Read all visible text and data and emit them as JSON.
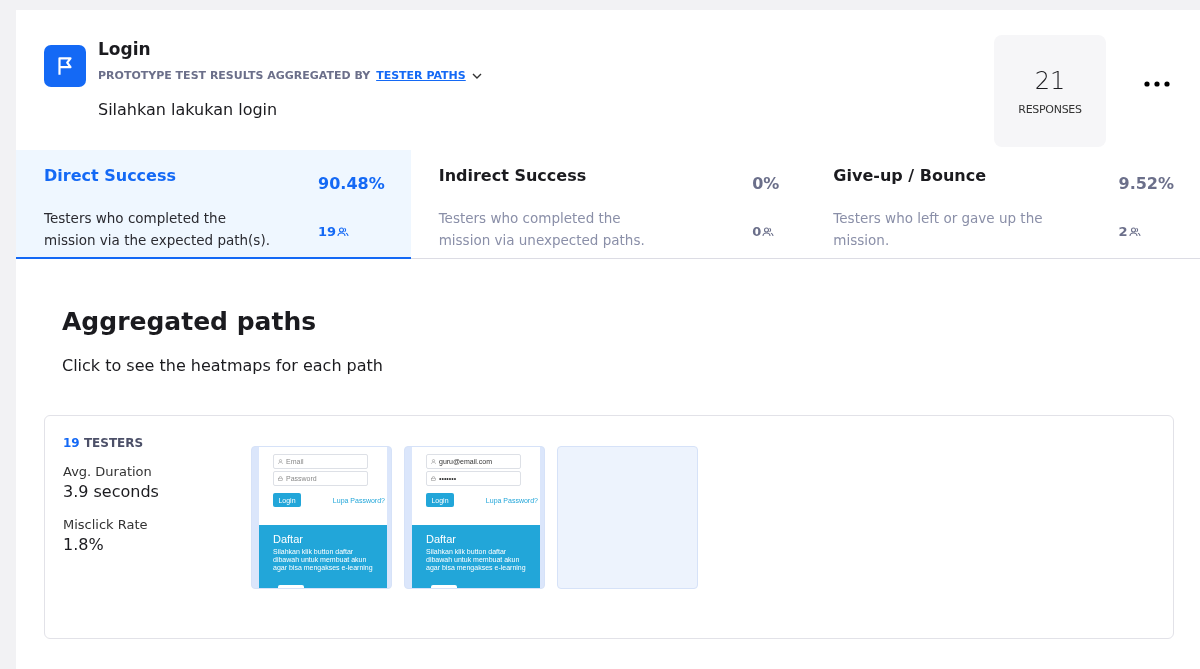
{
  "header": {
    "title": "Login",
    "subtitle": "PROTOTYPE TEST RESULTS AGGREGATED BY",
    "aggregation": "TESTER PATHS",
    "description": "Silahkan lakukan login"
  },
  "responses": {
    "count": "21",
    "label": "RESPONSES"
  },
  "tabs": [
    {
      "title": "Direct Success",
      "percent": "90.48%",
      "description": "Testers who completed the mission via the expected path(s).",
      "count": "19",
      "selected": true
    },
    {
      "title": "Indirect Success",
      "percent": "0%",
      "description": "Testers who completed the mission via unexpected paths.",
      "count": "0",
      "selected": false
    },
    {
      "title": "Give-up / Bounce",
      "percent": "9.52%",
      "description": "Testers who left or gave up the mission.",
      "count": "2",
      "selected": false
    }
  ],
  "section": {
    "title": "Aggregated paths",
    "subtitle": "Click to see the heatmaps for each path"
  },
  "paths": [
    {
      "testers_count": "19",
      "testers_label": "TESTERS",
      "metrics": [
        {
          "label": "Avg. Duration",
          "value": "3.9 seconds"
        },
        {
          "label": "Misclick Rate",
          "value": "1.8%"
        }
      ],
      "screens": [
        {
          "kind": "login",
          "fields": [
            {
              "placeholder": "Email"
            },
            {
              "placeholder": "Password"
            }
          ],
          "button": "Login",
          "link": "Lupa Password?",
          "heading": "Daftar",
          "text": "Silahkan klik button daftar dibawah untuk membuat akun agar bisa mengakses e-learning"
        },
        {
          "kind": "login",
          "fields": [
            {
              "value": "guru@email.com"
            },
            {
              "value": "•••••••"
            }
          ],
          "button": "Login",
          "link": "Lupa Password?",
          "heading": "Daftar",
          "text": "Silahkan klik button daftar dibawah untuk membuat akun agar bisa mengakses e-learning"
        },
        {
          "kind": "blank"
        }
      ]
    }
  ]
}
